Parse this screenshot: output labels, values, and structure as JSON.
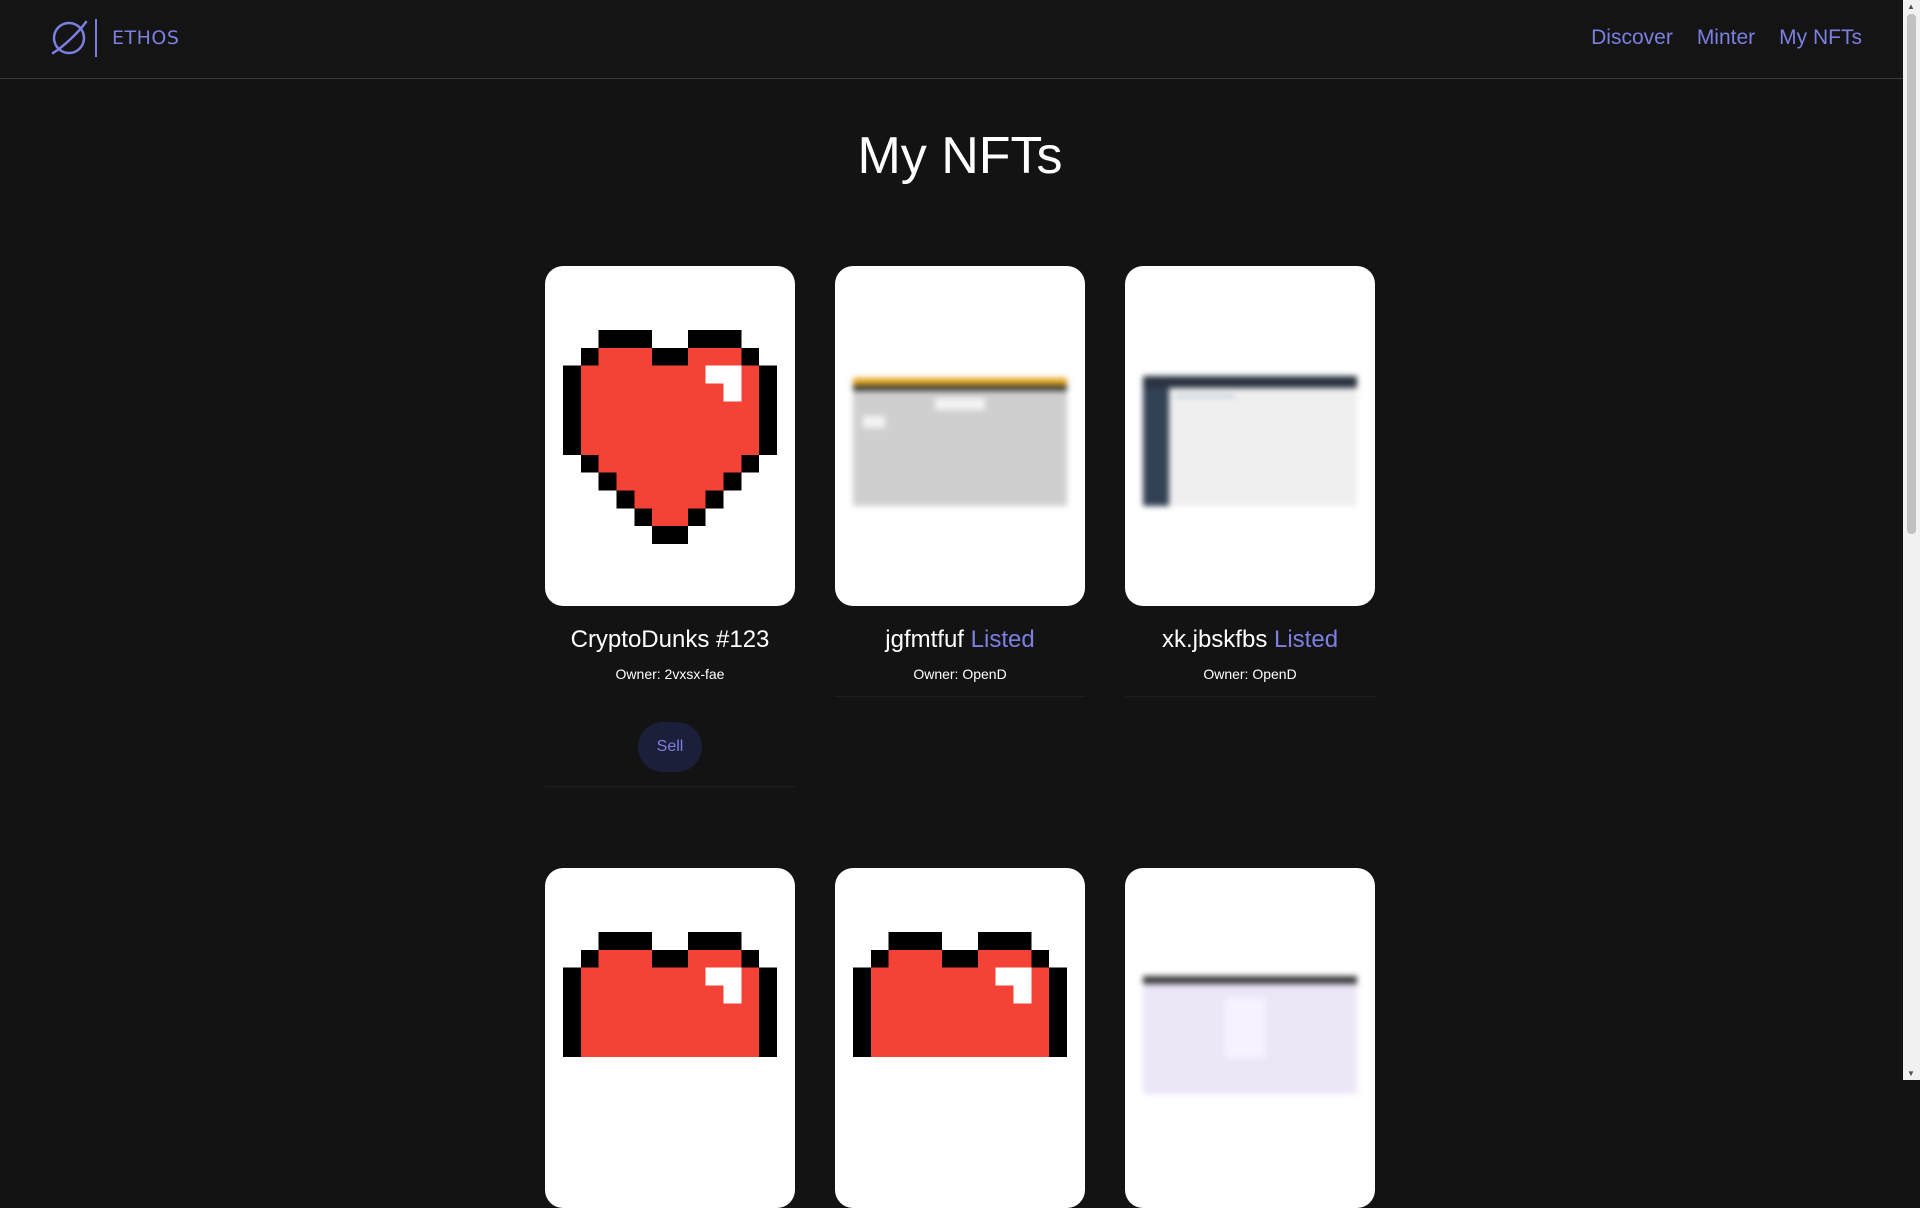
{
  "header": {
    "brand": "ETHOS",
    "nav": [
      "Discover",
      "Minter",
      "My NFTs"
    ],
    "accent": "#7b7fe0"
  },
  "page": {
    "title": "My NFTs"
  },
  "cards": [
    {
      "name": "CryptoDunks #123",
      "status": "",
      "owner_label": "Owner: 2vxsx-fae",
      "image": "pixel-heart",
      "action": "Sell"
    },
    {
      "name": "jgfmtfuf",
      "status": "Listed",
      "owner_label": "Owner: OpenD",
      "image": "blurred-screenshot-yellow"
    },
    {
      "name": "xk.jbskfbs",
      "status": "Listed",
      "owner_label": "Owner: OpenD",
      "image": "blurred-screenshot-dark"
    },
    {
      "image": "pixel-heart"
    },
    {
      "image": "pixel-heart"
    },
    {
      "image": "blurred-screenshot-purple"
    }
  ]
}
